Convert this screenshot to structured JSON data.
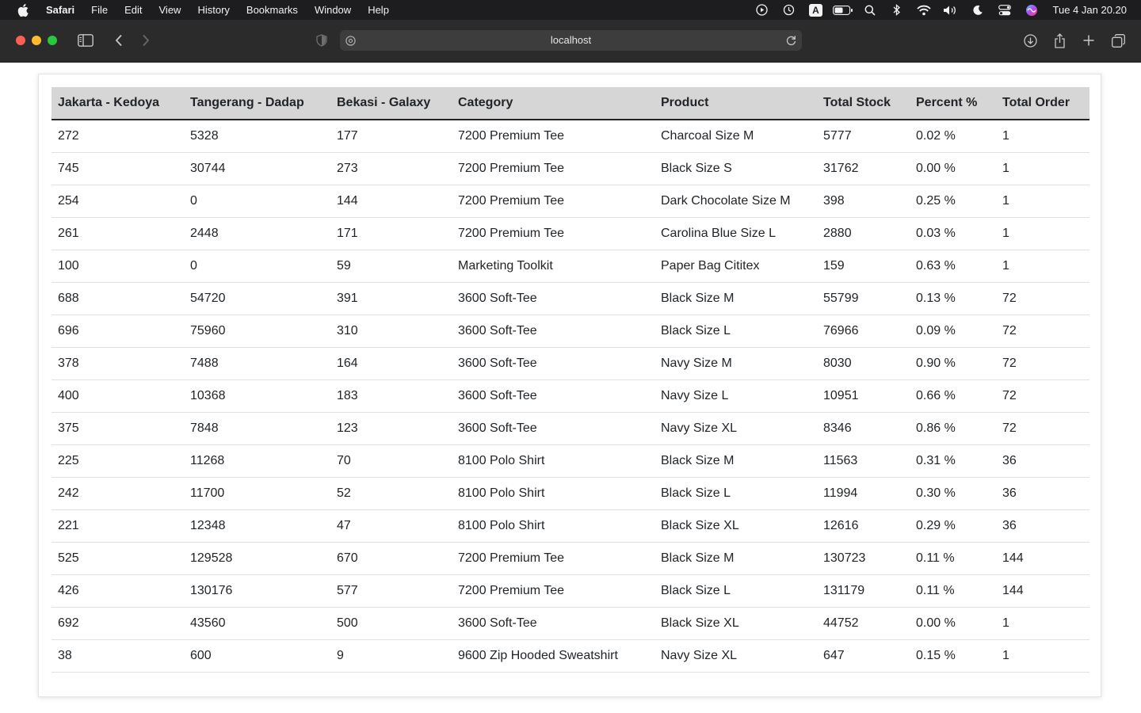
{
  "menubar": {
    "items": [
      "Safari",
      "File",
      "Edit",
      "View",
      "History",
      "Bookmarks",
      "Window",
      "Help"
    ],
    "input_badge": "A",
    "clock": "Tue 4 Jan  20.20"
  },
  "browser": {
    "url": "localhost"
  },
  "table": {
    "headers": [
      "Jakarta - Kedoya",
      "Tangerang - Dadap",
      "Bekasi - Galaxy",
      "Category",
      "Product",
      "Total Stock",
      "Percent %",
      "Total Order"
    ],
    "rows": [
      [
        "272",
        "5328",
        "177",
        "7200 Premium Tee",
        "Charcoal Size M",
        "5777",
        "0.02 %",
        "1"
      ],
      [
        "745",
        "30744",
        "273",
        "7200 Premium Tee",
        "Black Size S",
        "31762",
        "0.00 %",
        "1"
      ],
      [
        "254",
        "0",
        "144",
        "7200 Premium Tee",
        "Dark Chocolate Size M",
        "398",
        "0.25 %",
        "1"
      ],
      [
        "261",
        "2448",
        "171",
        "7200 Premium Tee",
        "Carolina Blue Size L",
        "2880",
        "0.03 %",
        "1"
      ],
      [
        "100",
        "0",
        "59",
        "Marketing Toolkit",
        "Paper Bag Cititex",
        "159",
        "0.63 %",
        "1"
      ],
      [
        "688",
        "54720",
        "391",
        "3600 Soft-Tee",
        "Black Size M",
        "55799",
        "0.13 %",
        "72"
      ],
      [
        "696",
        "75960",
        "310",
        "3600 Soft-Tee",
        "Black Size L",
        "76966",
        "0.09 %",
        "72"
      ],
      [
        "378",
        "7488",
        "164",
        "3600 Soft-Tee",
        "Navy Size M",
        "8030",
        "0.90 %",
        "72"
      ],
      [
        "400",
        "10368",
        "183",
        "3600 Soft-Tee",
        "Navy Size L",
        "10951",
        "0.66 %",
        "72"
      ],
      [
        "375",
        "7848",
        "123",
        "3600 Soft-Tee",
        "Navy Size XL",
        "8346",
        "0.86 %",
        "72"
      ],
      [
        "225",
        "11268",
        "70",
        "8100 Polo Shirt",
        "Black Size M",
        "11563",
        "0.31 %",
        "36"
      ],
      [
        "242",
        "11700",
        "52",
        "8100 Polo Shirt",
        "Black Size L",
        "11994",
        "0.30 %",
        "36"
      ],
      [
        "221",
        "12348",
        "47",
        "8100 Polo Shirt",
        "Black Size XL",
        "12616",
        "0.29 %",
        "36"
      ],
      [
        "525",
        "129528",
        "670",
        "7200 Premium Tee",
        "Black Size M",
        "130723",
        "0.11 %",
        "144"
      ],
      [
        "426",
        "130176",
        "577",
        "7200 Premium Tee",
        "Black Size L",
        "131179",
        "0.11 %",
        "144"
      ],
      [
        "692",
        "43560",
        "500",
        "3600 Soft-Tee",
        "Black Size XL",
        "44752",
        "0.00 %",
        "1"
      ],
      [
        "38",
        "600",
        "9",
        "9600 Zip Hooded Sweatshirt",
        "Navy Size XL",
        "647",
        "0.15 %",
        "1"
      ]
    ]
  }
}
